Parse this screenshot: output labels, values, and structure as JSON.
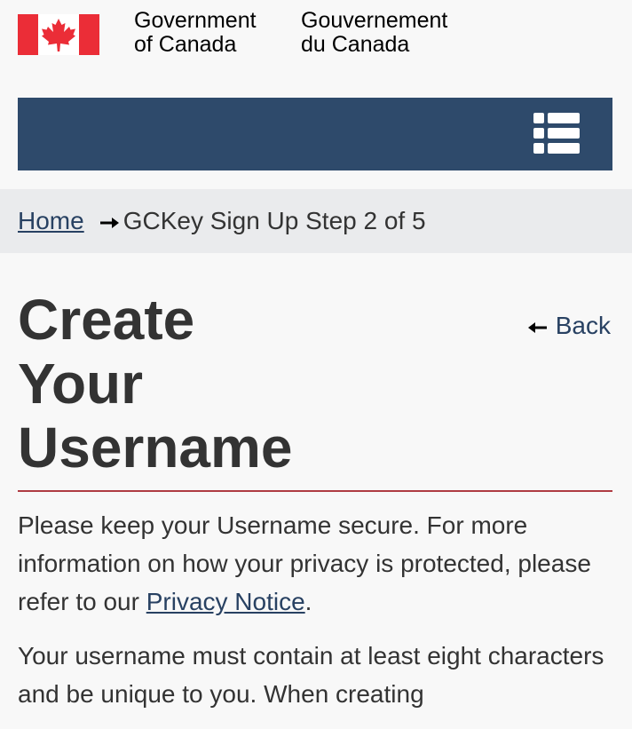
{
  "header": {
    "signature_en_line1": "Government",
    "signature_en_line2": "of Canada",
    "signature_fr_line1": "Gouvernement",
    "signature_fr_line2": "du Canada"
  },
  "colors": {
    "flag_red": "#eb2d37",
    "menu_bar": "#2e4a6b",
    "link": "#284162",
    "title_rule": "#af3c43"
  },
  "icons": {
    "flag": "canada-flag-icon",
    "menu": "list-menu-icon",
    "breadcrumb_separator": "arrow-right-icon",
    "back": "arrow-left-icon"
  },
  "breadcrumb": {
    "home_label": "Home",
    "current_label": "GCKey Sign Up Step 2 of 5"
  },
  "page": {
    "title_line1": "Create",
    "title_line2": "Your",
    "title_line3": "Username",
    "back_label": "Back"
  },
  "content": {
    "para1_before": "Please keep your Username secure. For more information on how your privacy is protected, please refer to our ",
    "para1_link": "Privacy Notice",
    "para1_after": ".",
    "para2": "Your username must contain at least eight characters and be unique to you. When creating"
  }
}
